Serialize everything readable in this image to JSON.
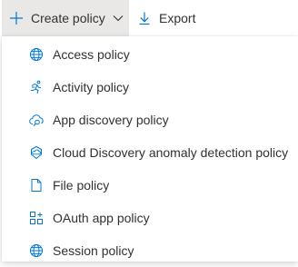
{
  "toolbar": {
    "create_label": "Create policy",
    "create_icon": "add-icon",
    "export_label": "Export",
    "export_icon": "download-icon",
    "accent_color": "#0078d4",
    "active_bg": "#e9e8e6"
  },
  "menu": {
    "items": [
      {
        "label": "Access policy",
        "icon": "globe-icon"
      },
      {
        "label": "Activity policy",
        "icon": "running-person-icon"
      },
      {
        "label": "App discovery policy",
        "icon": "cloud-search-icon"
      },
      {
        "label": "Cloud Discovery anomaly detection policy",
        "icon": "cloud-anomaly-icon"
      },
      {
        "label": "File policy",
        "icon": "file-icon"
      },
      {
        "label": "OAuth app policy",
        "icon": "app-grid-icon"
      },
      {
        "label": "Session policy",
        "icon": "globe-icon"
      }
    ]
  }
}
